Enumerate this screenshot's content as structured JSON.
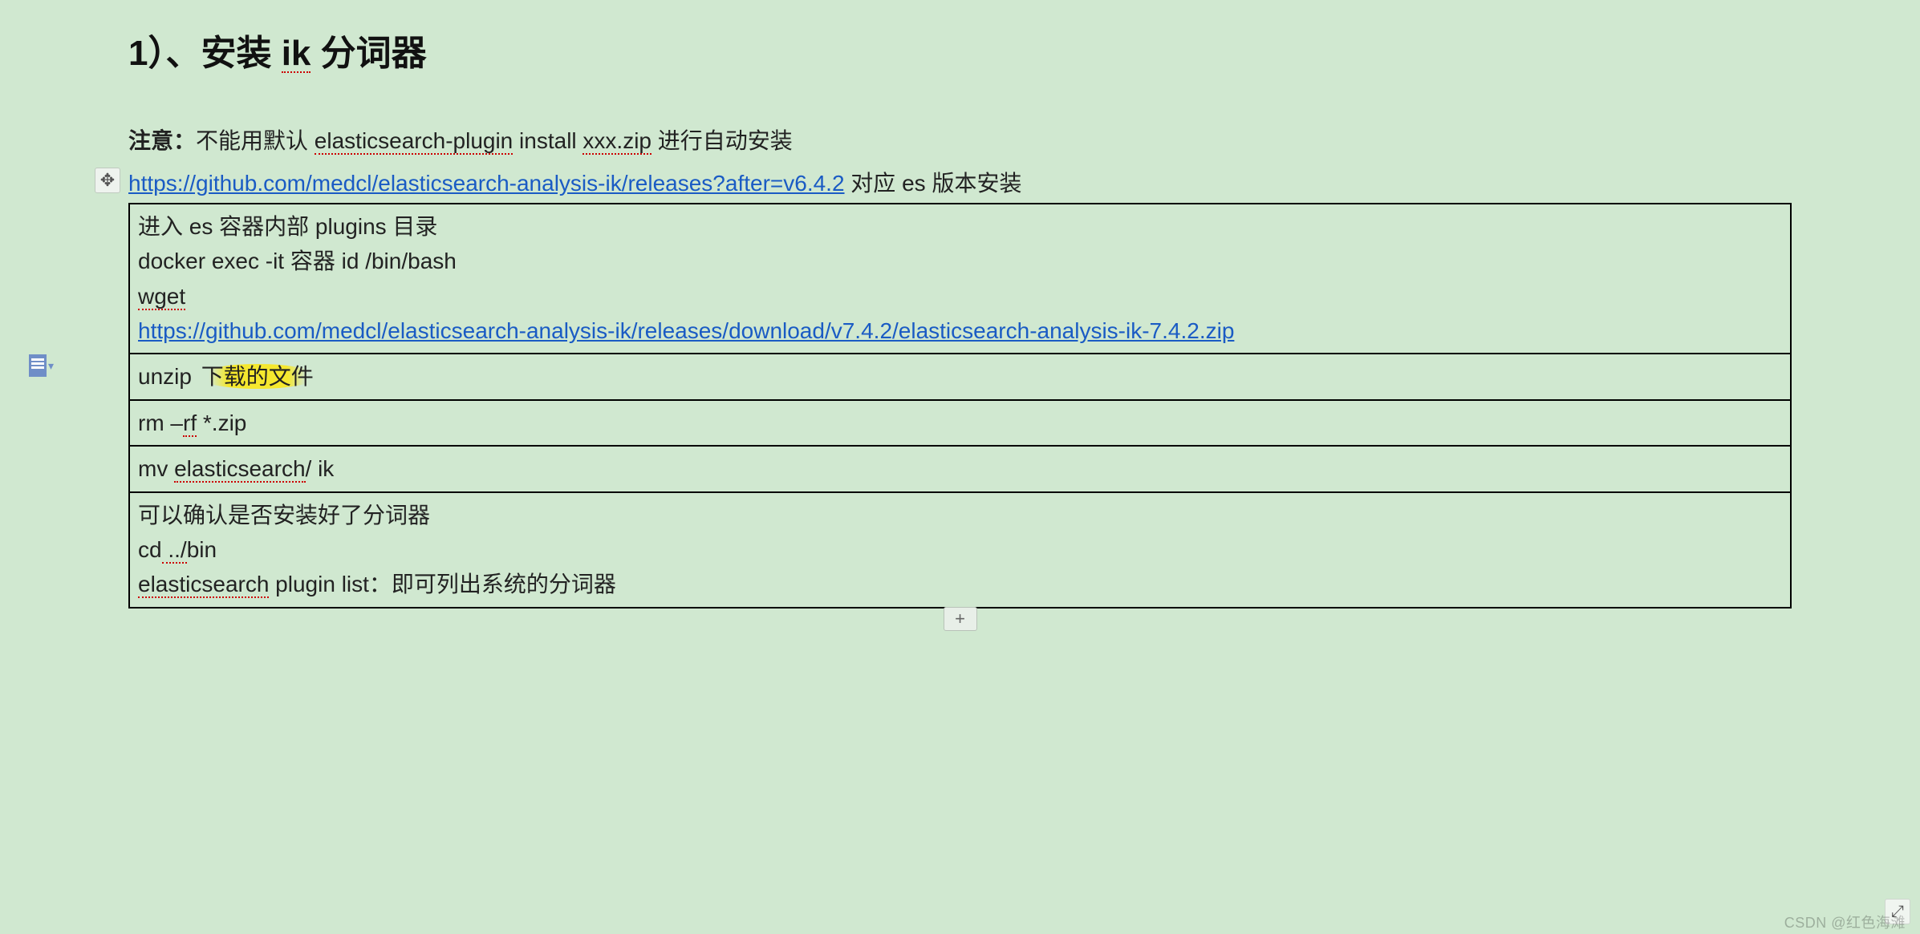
{
  "heading": {
    "prefix": "1）、安装 ",
    "squiggle": "ik",
    "suffix": " 分词器"
  },
  "note": {
    "label": "注意：",
    "pre": "不能用默认 ",
    "cmd": "elasticsearch-plugin",
    "mid": " install ",
    "file": "xxx.zip",
    "post": "  进行自动安装"
  },
  "link1": {
    "url": "https://github.com/medcl/elasticsearch-analysis-ik/releases?after=v6.4.2",
    "tail": "  对应 es 版本安装"
  },
  "table": {
    "r1": {
      "l1": "进入 es 容器内部  plugins 目录",
      "l2": "docker exec -it  容器 id /bin/bash",
      "l3a": "wget",
      "l4_link": "https://github.com/medcl/elasticsearch-analysis-ik/releases/download/v7.4.2/elasticsearch-analysis-ik-7.4.2.zip"
    },
    "r2": {
      "pre": "unzip  ",
      "hi": "下载的文件"
    },
    "r3": {
      "pre": "rm –",
      "sq": "rf",
      "post": " *.zip"
    },
    "r4": {
      "pre": "mv ",
      "sq": "elasticsearch",
      "post": "/ ik"
    },
    "r5": {
      "l1": "可以确认是否安装好了分词器",
      "l2_pre": "cd",
      "l2_sq": " ../",
      "l2_post": "bin",
      "l3_pre": "elasticsearch",
      "l3_mid": " plugin list：即可列出系统的分词器"
    }
  },
  "icons": {
    "move": "✥",
    "plus": "+",
    "resize": "⤢",
    "caret": "▾"
  },
  "watermark": "CSDN @红色海滩"
}
